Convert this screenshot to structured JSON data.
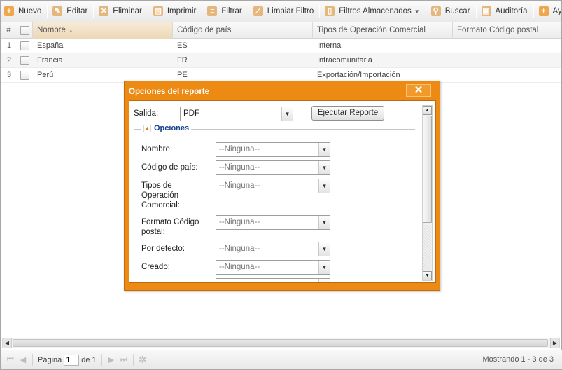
{
  "toolbar": {
    "nuevo": "Nuevo",
    "editar": "Editar",
    "eliminar": "Eliminar",
    "imprimir": "Imprimir",
    "filtrar": "Filtrar",
    "limpiar_filtro": "Limpiar Filtro",
    "filtros_almacenados": "Filtros Almacenados",
    "buscar": "Buscar",
    "auditoria": "Auditoría",
    "ayuda": "Ayuda"
  },
  "grid": {
    "headers": {
      "num": "#",
      "nombre": "Nombre",
      "codigo": "Código de país",
      "tipos": "Tipos de Operación Comercial",
      "formato": "Formato Código postal"
    },
    "rows": [
      {
        "num": "1",
        "nombre": "España",
        "codigo": "ES",
        "tipo": "Interna",
        "formato": ""
      },
      {
        "num": "2",
        "nombre": "Francia",
        "codigo": "FR",
        "tipo": "Intracomunitaria",
        "formato": ""
      },
      {
        "num": "3",
        "nombre": "Perú",
        "codigo": "PE",
        "tipo": "Exportación/Importación",
        "formato": ""
      }
    ]
  },
  "pager": {
    "pagina_label": "Página",
    "page_value": "1",
    "of_label": "de 1",
    "status": "Mostrando 1 - 3 de 3"
  },
  "modal": {
    "title": "Opciones del reporte",
    "close": "✕",
    "salida_label": "Salida:",
    "salida_value": "PDF",
    "ejecutar": "Ejecutar Reporte",
    "opciones_legend": "Opciones",
    "options": [
      {
        "label": "Nombre:",
        "value": "--Ninguna--"
      },
      {
        "label": "Código de país:",
        "value": "--Ninguna--"
      },
      {
        "label": "Tipos de Operación Comercial:",
        "value": "--Ninguna--"
      },
      {
        "label": "Formato Código postal:",
        "value": "--Ninguna--"
      },
      {
        "label": "Por defecto:",
        "value": "--Ninguna--"
      },
      {
        "label": "Creado:",
        "value": "--Ninguna--"
      }
    ]
  },
  "colors": {
    "modal_accent": "#ec8a13",
    "legend_text": "#15428b"
  }
}
